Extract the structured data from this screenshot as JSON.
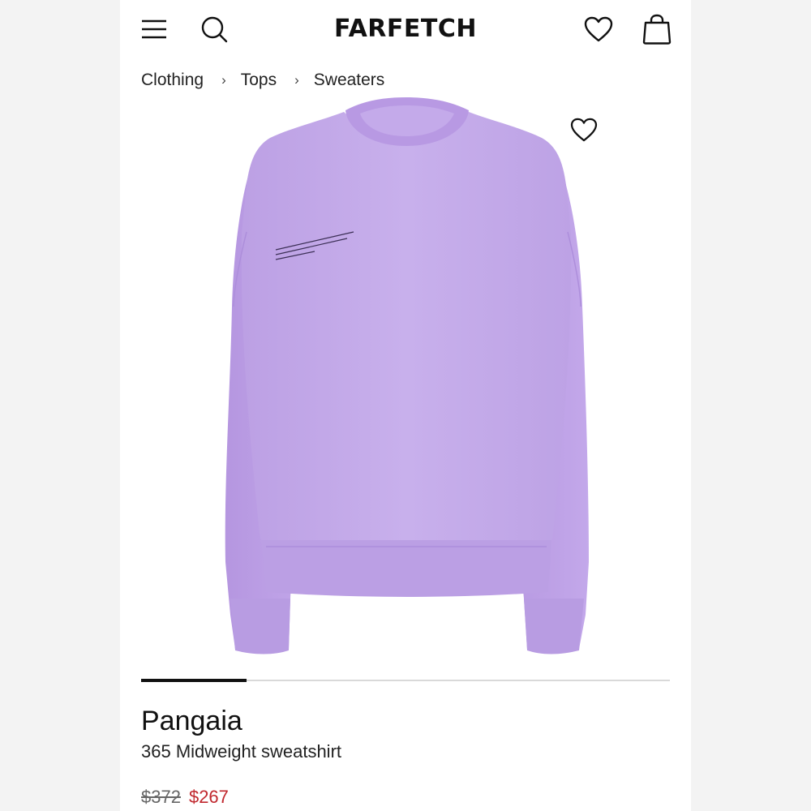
{
  "header": {
    "logo_text": "FARFETCH",
    "icons": {
      "menu": "menu-icon",
      "search": "search-icon",
      "wishlist": "heart-icon",
      "bag": "shopping-bag-icon"
    }
  },
  "breadcrumb": {
    "items": [
      "Clothing",
      "Tops",
      "Sweaters"
    ],
    "separator": "›"
  },
  "gallery": {
    "image": "lavender-sweatshirt-photo",
    "favorite_icon": "heart-outline-icon",
    "current_slide_fraction": 0.2
  },
  "product": {
    "brand": "Pangaia",
    "name": "365 Midweight sweatshirt",
    "original_price": "$372",
    "sale_price": "$267"
  },
  "colors": {
    "sweatshirt": "#c7aee9",
    "sale_price": "#c0272d",
    "text": "#111111"
  }
}
